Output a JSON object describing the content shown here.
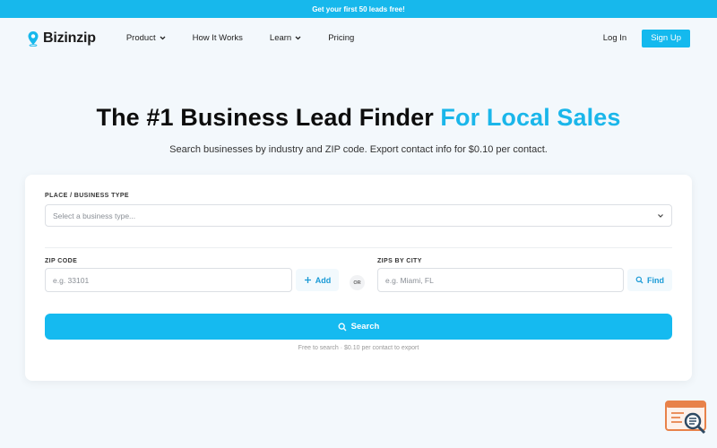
{
  "banner": {
    "text": "Get your first 50 leads free!"
  },
  "nav": {
    "logo_text": "Bizinzip",
    "links": [
      {
        "label": "Product"
      },
      {
        "label": "How It Works"
      },
      {
        "label": "Learn"
      },
      {
        "label": "Pricing"
      }
    ],
    "login": "Log In",
    "signup": "Sign Up"
  },
  "hero": {
    "title_main": "The #1 Business Lead Finder ",
    "title_accent": "For Local Sales",
    "subtitle": "Search businesses by industry and ZIP code. Export contact info for $0.10 per contact."
  },
  "form": {
    "place_label": "PLACE / BUSINESS TYPE",
    "place_placeholder": "Select a business type...",
    "zip_label": "ZIP CODE",
    "zip_placeholder": "e.g. 33101",
    "add_label": "Add",
    "or_label": "OR",
    "city_label": "ZIPS BY CITY",
    "city_placeholder": "e.g. Miami, FL",
    "find_label": "Find",
    "search_label": "Search",
    "note": "Free to search · $0.10 per contact to export"
  },
  "colors": {
    "accent": "#15baf0",
    "widget": "#e8824a"
  },
  "icons": [
    "location-pin-icon",
    "chevron-down-icon",
    "plus-icon",
    "search-icon",
    "chat-widget-icon"
  ]
}
